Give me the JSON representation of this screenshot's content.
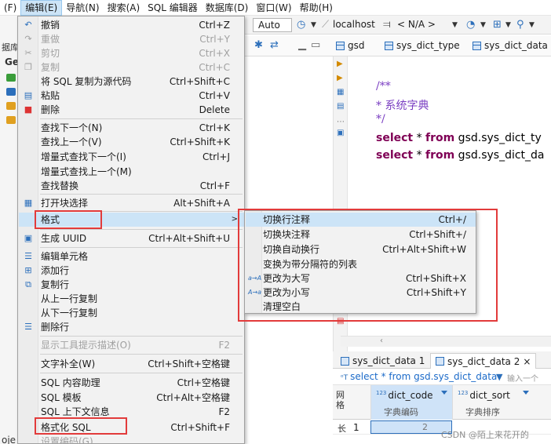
{
  "menubar": {
    "items": [
      {
        "label": "(F)"
      },
      {
        "label": "编辑(E)"
      },
      {
        "label": "导航(N)"
      },
      {
        "label": "搜索(A)"
      },
      {
        "label": "SQL 编辑器"
      },
      {
        "label": "数据库(D)"
      },
      {
        "label": "窗口(W)"
      },
      {
        "label": "帮助(H)"
      }
    ]
  },
  "left_panel": {
    "label_top": "据库",
    "label_ge": "Ge",
    "label_bottom": "oje"
  },
  "toolbar": {
    "mode": "Auto",
    "connection": "localhost",
    "schema": "< N/A >"
  },
  "editor_tabs": [
    {
      "label": "gsd"
    },
    {
      "label": "sys_dict_type"
    },
    {
      "label": "sys_dict_data"
    }
  ],
  "editor": {
    "line1": "/**",
    "line2": " * 系统字典",
    "line3": " */",
    "q1_kw1": "select",
    "q1_star": " * ",
    "q1_kw2": "from",
    "q1_obj": " gsd.sys_dict_ty",
    "q2_kw1": "select",
    "q2_star": " * ",
    "q2_kw2": "from",
    "q2_obj": " gsd.sys_dict_da"
  },
  "edit_menu": {
    "items": [
      {
        "label": "撤销",
        "shortcut": "Ctrl+Z",
        "icon": "undo-icon"
      },
      {
        "label": "重做",
        "shortcut": "Ctrl+Y",
        "icon": "redo-icon",
        "disabled": true
      },
      {
        "label": "剪切",
        "shortcut": "Ctrl+X",
        "icon": "cut-icon",
        "disabled": true
      },
      {
        "label": "复制",
        "shortcut": "Ctrl+C",
        "icon": "copy-icon",
        "disabled": true
      },
      {
        "label": "将 SQL 复制为源代码",
        "shortcut": "Ctrl+Shift+C"
      },
      {
        "label": "粘贴",
        "shortcut": "Ctrl+V",
        "icon": "paste-icon"
      },
      {
        "label": "删除",
        "shortcut": "Delete",
        "icon": "delete-icon"
      },
      {
        "label": "查找下一个(N)",
        "shortcut": "Ctrl+K"
      },
      {
        "label": "查找上一个(V)",
        "shortcut": "Ctrl+Shift+K"
      },
      {
        "label": "增量式查找下一个(I)",
        "shortcut": "Ctrl+J"
      },
      {
        "label": "增量式查找上一个(M)",
        "shortcut": ""
      },
      {
        "label": "查找替换",
        "shortcut": "Ctrl+F"
      },
      {
        "label": "打开块选择",
        "shortcut": "Alt+Shift+A",
        "icon": "block-select-icon"
      },
      {
        "label": "格式",
        "shortcut": ""
      },
      {
        "label": "生成 UUID",
        "shortcut": "Ctrl+Alt+Shift+U",
        "icon": "uuid-icon"
      },
      {
        "label": "编辑单元格",
        "shortcut": "",
        "icon": "edit-cell-icon"
      },
      {
        "label": "添加行",
        "shortcut": "",
        "icon": "add-row-icon"
      },
      {
        "label": "复制行",
        "shortcut": "",
        "icon": "copy-row-icon"
      },
      {
        "label": "从上一行复制",
        "shortcut": ""
      },
      {
        "label": "从下一行复制",
        "shortcut": ""
      },
      {
        "label": "删除行",
        "shortcut": "",
        "icon": "delete-row-icon"
      },
      {
        "label": "显示工具提示描述(O)",
        "shortcut": "F2",
        "disabled": true
      },
      {
        "label": "文字补全(W)",
        "shortcut": "Ctrl+Shift+空格键"
      },
      {
        "label": "SQL 内容助理",
        "shortcut": "Ctrl+空格键"
      },
      {
        "label": "SQL 模板",
        "shortcut": "Ctrl+Alt+空格键"
      },
      {
        "label": "SQL 上下文信息",
        "shortcut": "F2"
      },
      {
        "label": "格式化 SQL",
        "shortcut": "Ctrl+Shift+F"
      },
      {
        "label": "设置编码(G)...",
        "shortcut": ""
      }
    ]
  },
  "format_submenu": {
    "items": [
      {
        "label": "切换行注释",
        "shortcut": "Ctrl+/"
      },
      {
        "label": "切换块注释",
        "shortcut": "Ctrl+Shift+/"
      },
      {
        "label": "切换自动换行",
        "shortcut": "Ctrl+Alt+Shift+W"
      },
      {
        "label": "变换为带分隔符的列表",
        "shortcut": ""
      },
      {
        "label": "更改为大写",
        "shortcut": "Ctrl+Shift+X",
        "icon_text": "a→A"
      },
      {
        "label": "更改为小写",
        "shortcut": "Ctrl+Shift+Y",
        "icon_text": "A→a"
      },
      {
        "label": "清理空白",
        "shortcut": ""
      }
    ]
  },
  "results": {
    "tabs": [
      {
        "label": "sys_dict_data 1"
      },
      {
        "label": "sys_dict_data 2",
        "close": "×"
      }
    ],
    "filter_text": "select * from gsd.sys_dict_data",
    "filter_placeholder": "输入一个",
    "vertical_label": "网格",
    "columns": [
      {
        "type": "123",
        "name": "dict_code",
        "comment": "字典编码"
      },
      {
        "type": "123",
        "name": "dict_sort",
        "comment": "字典排序"
      }
    ],
    "row_number": "1",
    "row2_number": "2",
    "bottom_label": "长"
  },
  "watermark": "CSDN @陌上来花开的",
  "colors": {
    "highlight": "#cce4f7",
    "annotation": "#e23b3b",
    "keyword": "#7f0055"
  }
}
